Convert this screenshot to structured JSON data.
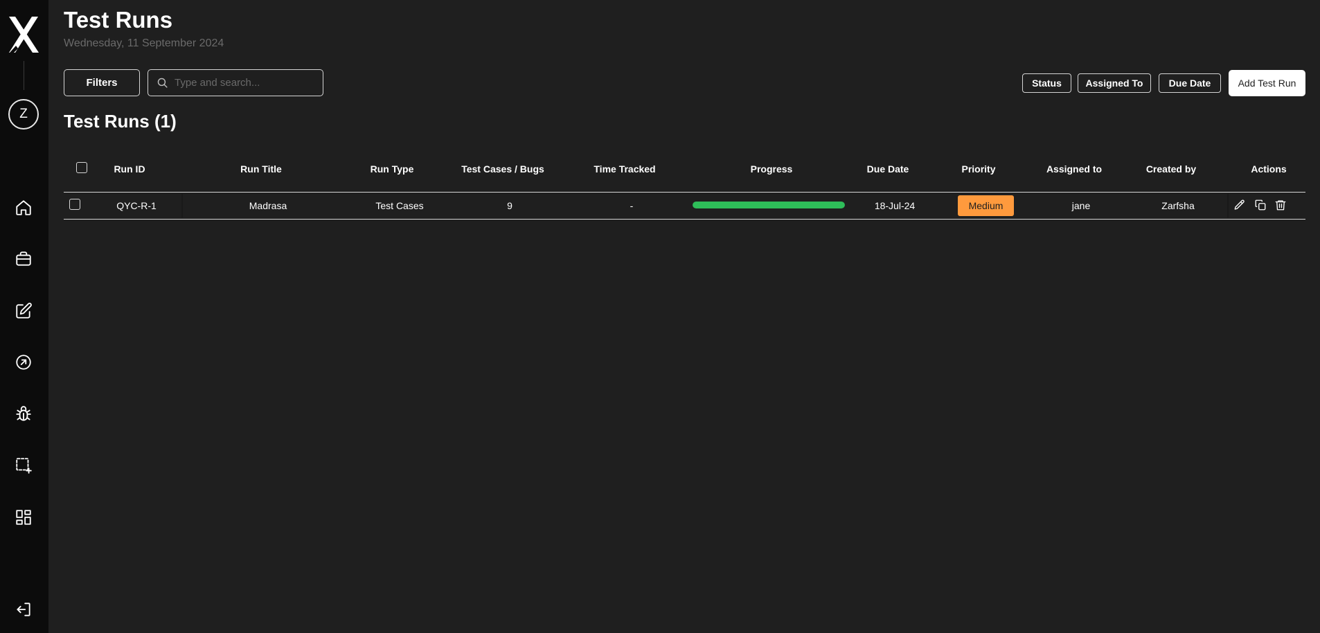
{
  "app": {
    "avatar_initial": "Z",
    "icons": {
      "logo": "x-logo",
      "nav": [
        "home-icon",
        "briefcase-icon",
        "edit-icon",
        "arrow-up-right-circle-icon",
        "bug-icon",
        "select-plus-icon",
        "dashboard-icon"
      ],
      "logout": "logout-icon"
    }
  },
  "header": {
    "title": "Test Runs",
    "date": "Wednesday, 11 September 2024"
  },
  "toolbar": {
    "filters_label": "Filters",
    "search_placeholder": "Type and search...",
    "status_label": "Status",
    "assigned_label": "Assigned To",
    "due_label": "Due Date",
    "add_label": "Add Test Run"
  },
  "section": {
    "title": "Test Runs (1)"
  },
  "table": {
    "columns": [
      "Run ID",
      "Run Title",
      "Run Type",
      "Test Cases / Bugs",
      "Time Tracked",
      "Progress",
      "Due Date",
      "Priority",
      "Assigned to",
      "Created by",
      "Actions"
    ],
    "rows": [
      {
        "run_id": "QYC-R-1",
        "title": "Madrasa",
        "type": "Test Cases",
        "count": "9",
        "time": "-",
        "progress": 1.0,
        "due": "18-Jul-24",
        "priority": "Medium",
        "assigned": "jane",
        "created": "Zarfsha"
      }
    ]
  },
  "colors": {
    "background": "#1f1f1f",
    "sidebar": "#0c0c0c",
    "progress": "#2ebd59",
    "priority_medium": "#ff9a3d",
    "muted_text": "#6a6a6a"
  }
}
